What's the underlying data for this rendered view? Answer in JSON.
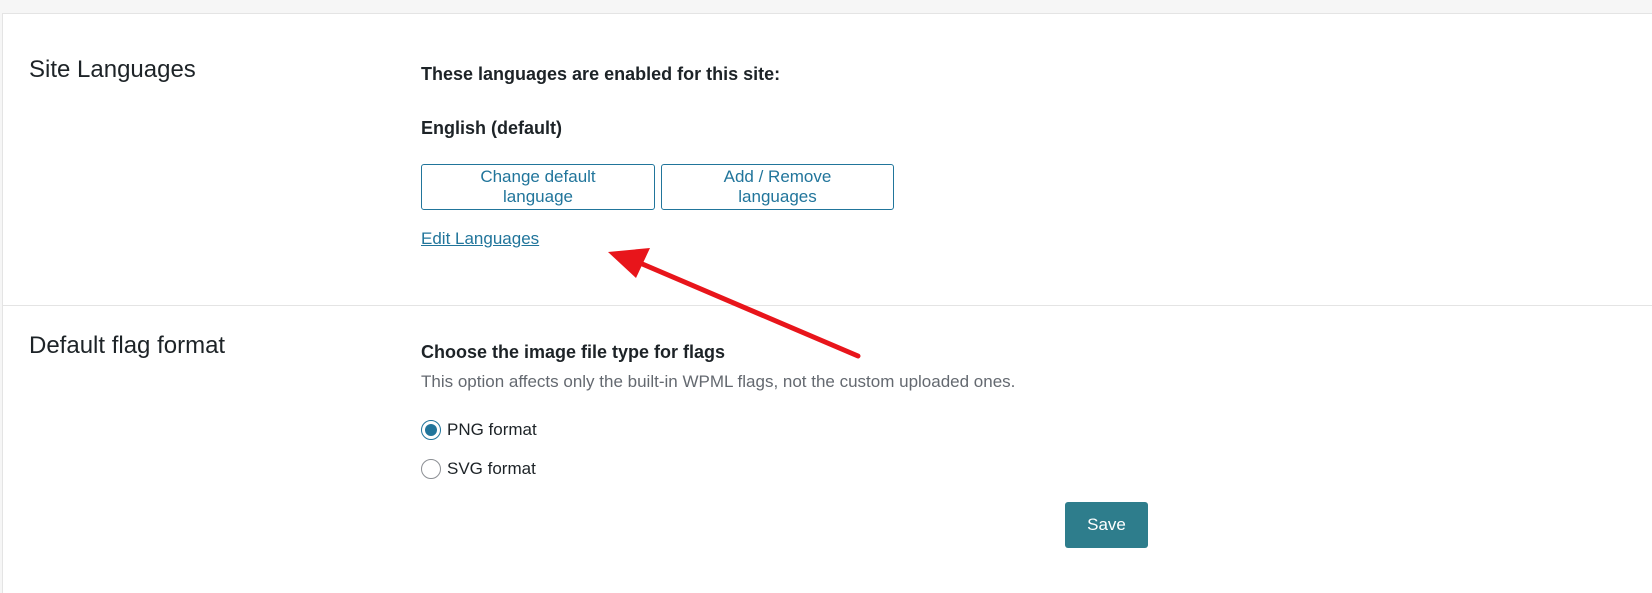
{
  "site_languages": {
    "title": "Site Languages",
    "enabled_heading": "These languages are enabled for this site:",
    "default_language": "English (default)",
    "change_default_button": "Change default language",
    "add_remove_button": "Add / Remove languages",
    "edit_link": "Edit Languages"
  },
  "flag_format": {
    "title": "Default flag format",
    "heading": "Choose the image file type for flags",
    "description": "This option affects only the built-in WPML flags, not the custom uploaded ones.",
    "options": [
      {
        "label": "PNG format",
        "checked": true
      },
      {
        "label": "SVG format",
        "checked": false
      }
    ],
    "save_button": "Save"
  },
  "colors": {
    "accent": "#21759b",
    "save_bg": "#2e7d8c",
    "annotation_arrow": "#e8151b"
  },
  "annotation": {
    "icon": "red-arrow-icon"
  }
}
